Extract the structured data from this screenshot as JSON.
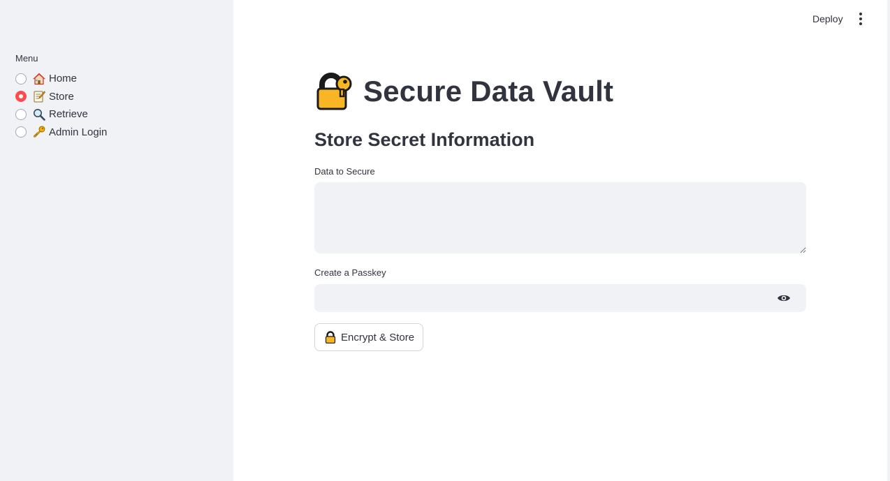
{
  "header": {
    "deploy_label": "Deploy",
    "more_icon": "vertical-ellipsis-icon"
  },
  "sidebar": {
    "menu_label": "Menu",
    "items": [
      {
        "label": "Home",
        "icon": "house-icon",
        "selected": false
      },
      {
        "label": "Store",
        "icon": "memo-icon",
        "selected": true
      },
      {
        "label": "Retrieve",
        "icon": "magnifying-glass-icon",
        "selected": false
      },
      {
        "label": "Admin Login",
        "icon": "key-icon",
        "selected": false
      }
    ],
    "accent_color": "#ff4b4b"
  },
  "main": {
    "title_icon": "locked-with-key-icon",
    "title": "Secure Data Vault",
    "subheader": "Store Secret Information",
    "data_field": {
      "label": "Data to Secure",
      "value": ""
    },
    "passkey_field": {
      "label": "Create a Passkey",
      "value": "",
      "toggle_icon": "eye-icon"
    },
    "submit_button": {
      "icon": "lock-icon",
      "label": "Encrypt & Store"
    }
  }
}
